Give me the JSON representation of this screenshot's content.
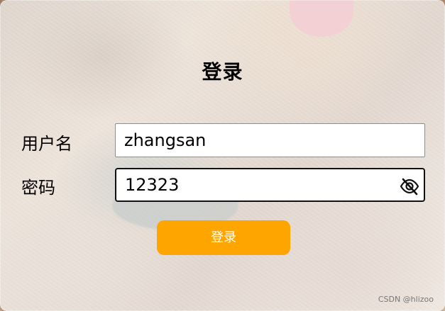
{
  "page": {
    "title": "登录"
  },
  "form": {
    "username_label": "用户名",
    "username_value": "zhangsan",
    "password_label": "密码",
    "password_value": "12323",
    "login_button_label": "登录",
    "password_visibility_icon": "eye-slash-icon"
  },
  "watermark": {
    "text": "CSDN @hlizoo"
  },
  "colors": {
    "accent": "#ffa500",
    "button_text": "#ffffff"
  }
}
